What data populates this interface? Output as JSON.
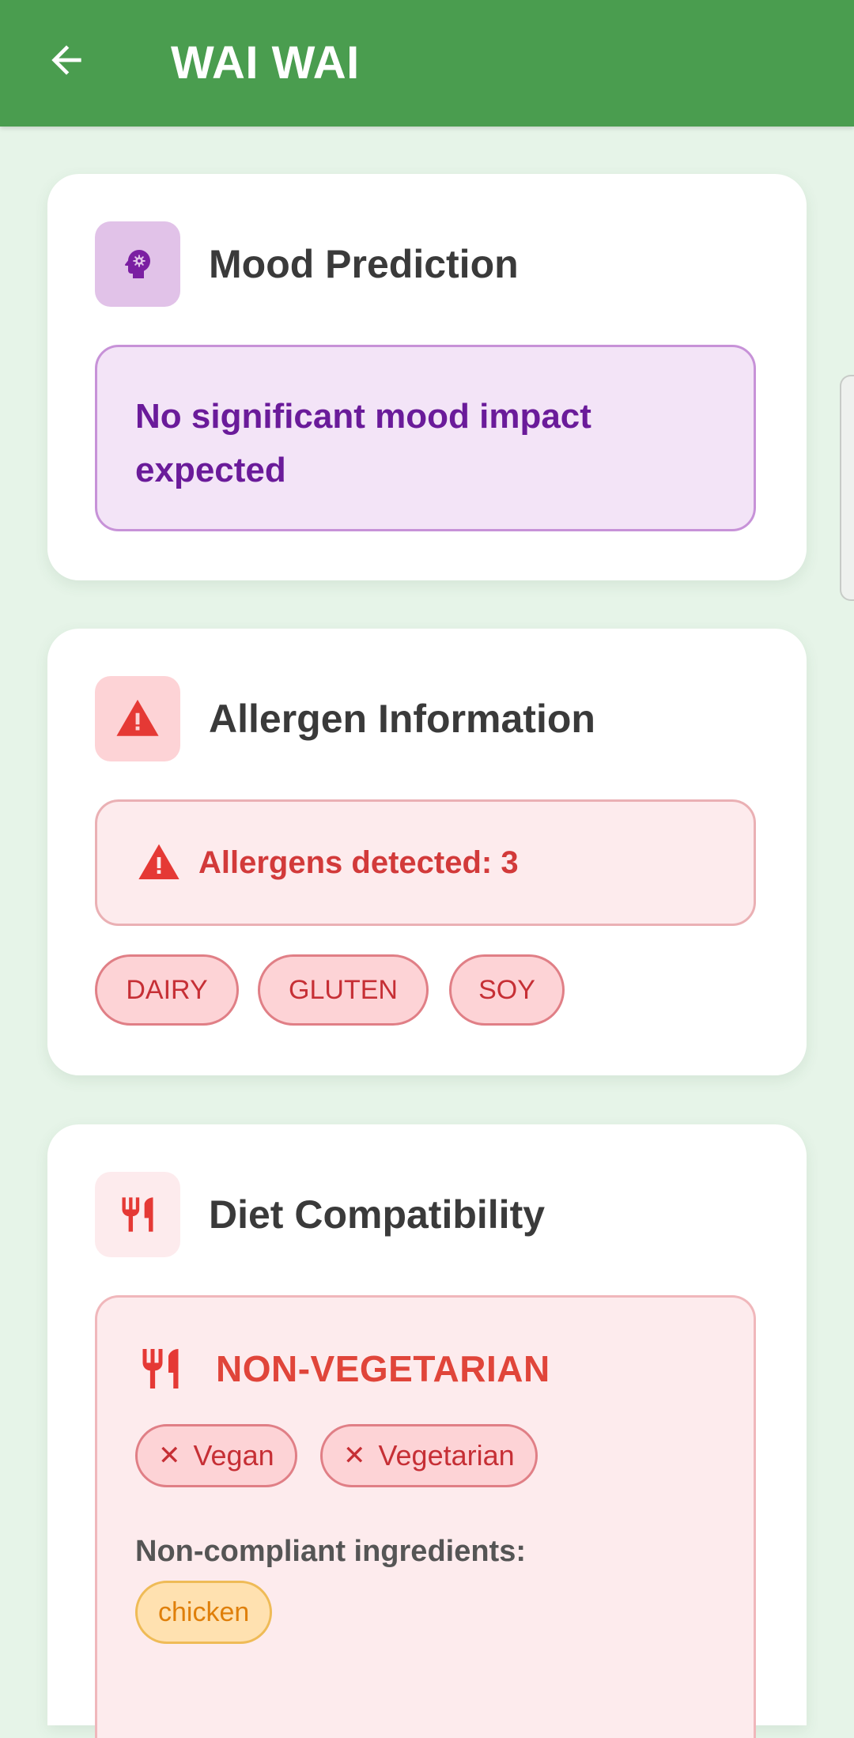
{
  "appbar": {
    "title": "WAI WAI",
    "back_icon": "arrow-left-icon"
  },
  "colors": {
    "appbar": "#4a9d4f",
    "background": "#e6f4e8",
    "mood_accent": "#7b1fa2",
    "allergen_accent": "#e53935",
    "ingredient_accent": "#df7f0a"
  },
  "mood": {
    "icon": "psychology-head-icon",
    "title": "Mood Prediction",
    "message": "No significant mood impact expected"
  },
  "allergen": {
    "icon": "warning-icon",
    "title": "Allergen Information",
    "alert_text": "Allergens detected: 3",
    "chips": [
      "DAIRY",
      "GLUTEN",
      "SOY"
    ]
  },
  "diet": {
    "icon": "restaurant-icon",
    "title": "Diet Compatibility",
    "status": "NON-VEGETARIAN",
    "incompatible": [
      "Vegan",
      "Vegetarian"
    ],
    "noncompliant_label": "Non-compliant ingredients:",
    "ingredients": [
      "chicken"
    ]
  }
}
